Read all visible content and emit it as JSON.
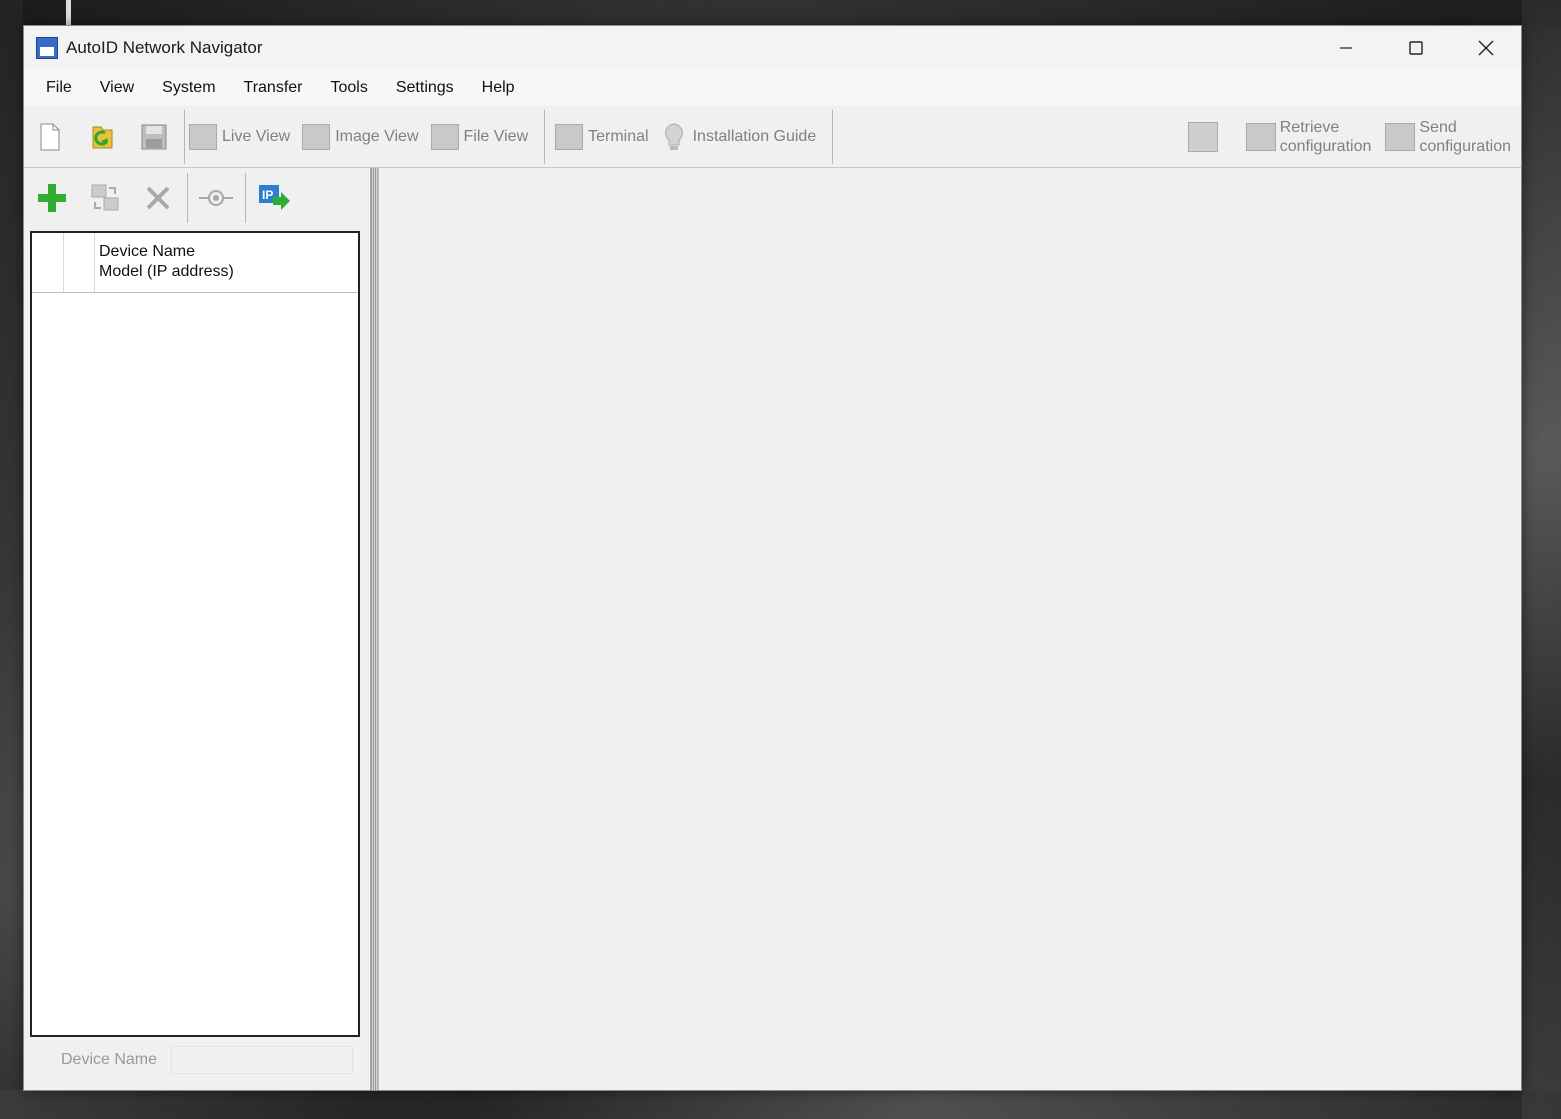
{
  "window": {
    "title": "AutoID Network Navigator",
    "controls": {
      "minimize": "—",
      "maximize": "☐",
      "close": "✕"
    }
  },
  "menubar": {
    "items": [
      "File",
      "View",
      "System",
      "Transfer",
      "Tools",
      "Settings",
      "Help"
    ]
  },
  "toolbar": {
    "file_icons": [
      "new-file-icon",
      "open-file-icon",
      "save-icon"
    ],
    "buttons": [
      {
        "label": "Live View",
        "icon": "live-view-icon"
      },
      {
        "label": "Image View",
        "icon": "image-view-icon"
      },
      {
        "label": "File View",
        "icon": "file-view-icon"
      },
      {
        "label": "Terminal",
        "icon": "terminal-icon"
      },
      {
        "label": "Installation Guide",
        "icon": "lightbulb-icon"
      }
    ],
    "right": {
      "retrieve_line1": "Retrieve",
      "retrieve_line2": "configuration",
      "send_line1": "Send",
      "send_line2": "configuration"
    }
  },
  "device_pane": {
    "toolbar_icons": [
      "add-device-icon",
      "change-device-icon",
      "delete-device-icon",
      "connect-icon",
      "ip-setting-icon"
    ],
    "list_header": {
      "line1": "Device Name",
      "line2": "Model (IP address)"
    },
    "device_name_label": "Device Name",
    "device_name_value": ""
  },
  "colors": {
    "add_green": "#2fae2f",
    "ip_blue": "#2a7fd4",
    "disabled_gray": "#808080"
  }
}
